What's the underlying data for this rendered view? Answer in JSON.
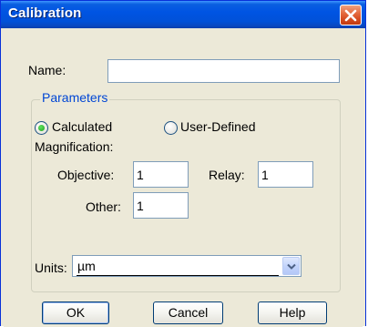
{
  "window": {
    "title": "Calibration"
  },
  "name_field": {
    "label": "Name:",
    "value": ""
  },
  "parameters": {
    "legend": "Parameters",
    "mode_options": [
      "Calculated",
      "User-Defined"
    ],
    "selected_mode": "Calculated",
    "magnification_label": "Magnification:",
    "objective": {
      "label": "Objective:",
      "value": "1"
    },
    "relay": {
      "label": "Relay:",
      "value": "1"
    },
    "other": {
      "label": "Other:",
      "value": "1"
    },
    "units": {
      "label": "Units:",
      "selected": "µm"
    }
  },
  "buttons": {
    "ok": "OK",
    "cancel": "Cancel",
    "help": "Help"
  },
  "colors": {
    "titlebar": "#0054e3",
    "close_button": "#e56c40",
    "dialog_bg": "#ece9d8",
    "group_label": "#0046d5"
  },
  "icons": {
    "close": "close-icon",
    "dropdown": "chevron-down-icon"
  }
}
